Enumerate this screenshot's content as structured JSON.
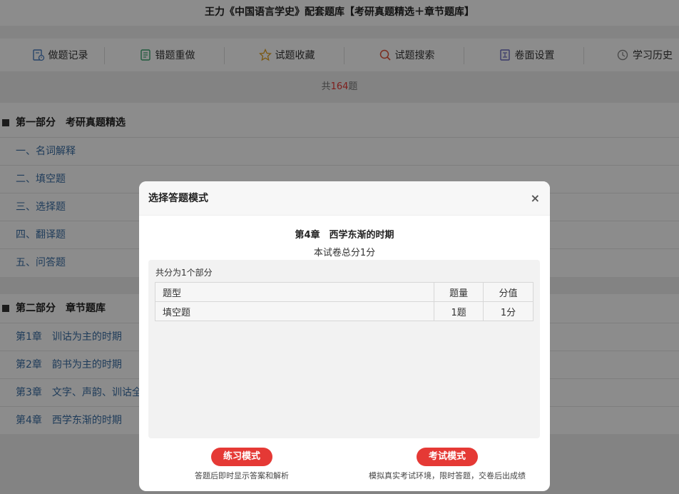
{
  "page": {
    "title": "王力《中国语言学史》配套题库【考研真题精选＋章节题库】"
  },
  "toolbar": {
    "items": [
      {
        "label": "做题记录",
        "icon": "record-icon"
      },
      {
        "label": "错题重做",
        "icon": "redo-icon"
      },
      {
        "label": "试题收藏",
        "icon": "star-icon"
      },
      {
        "label": "试题搜索",
        "icon": "search-icon"
      },
      {
        "label": "卷面设置",
        "icon": "settings-icon"
      },
      {
        "label": "学习历史",
        "icon": "history-icon"
      }
    ]
  },
  "summary": {
    "prefix": "共",
    "count": "164",
    "suffix": "题"
  },
  "sections": [
    {
      "title": "第一部分　考研真题精选",
      "items": [
        "一、名词解释",
        "二、填空题",
        "三、选择题",
        "四、翻译题",
        "五、问答题"
      ]
    },
    {
      "title": "第二部分　章节题库",
      "items": [
        "第1章　训诂为主的时期",
        "第2章　韵书为主的时期",
        "第3章　文字、声韵、训诂全",
        "第4章　西学东渐的时期"
      ]
    }
  ],
  "modal": {
    "title": "选择答题模式",
    "close": "×",
    "chapter": "第4章　西学东渐的时期",
    "total_score": "本试卷总分1分",
    "parts_text": "共分为1个部分",
    "table": {
      "headers": [
        "题型",
        "题量",
        "分值"
      ],
      "rows": [
        [
          "填空题",
          "1题",
          "1分"
        ]
      ]
    },
    "practice": {
      "label": "练习模式",
      "desc": "答题后即时显示答案和解析"
    },
    "exam": {
      "label": "考试模式",
      "desc": "模拟真实考试环境，限时答题，交卷后出成绩"
    }
  },
  "colors": {
    "accent": "#e53935",
    "link": "#3a6ea5",
    "overlay": "rgba(0,0,0,0.45)"
  }
}
